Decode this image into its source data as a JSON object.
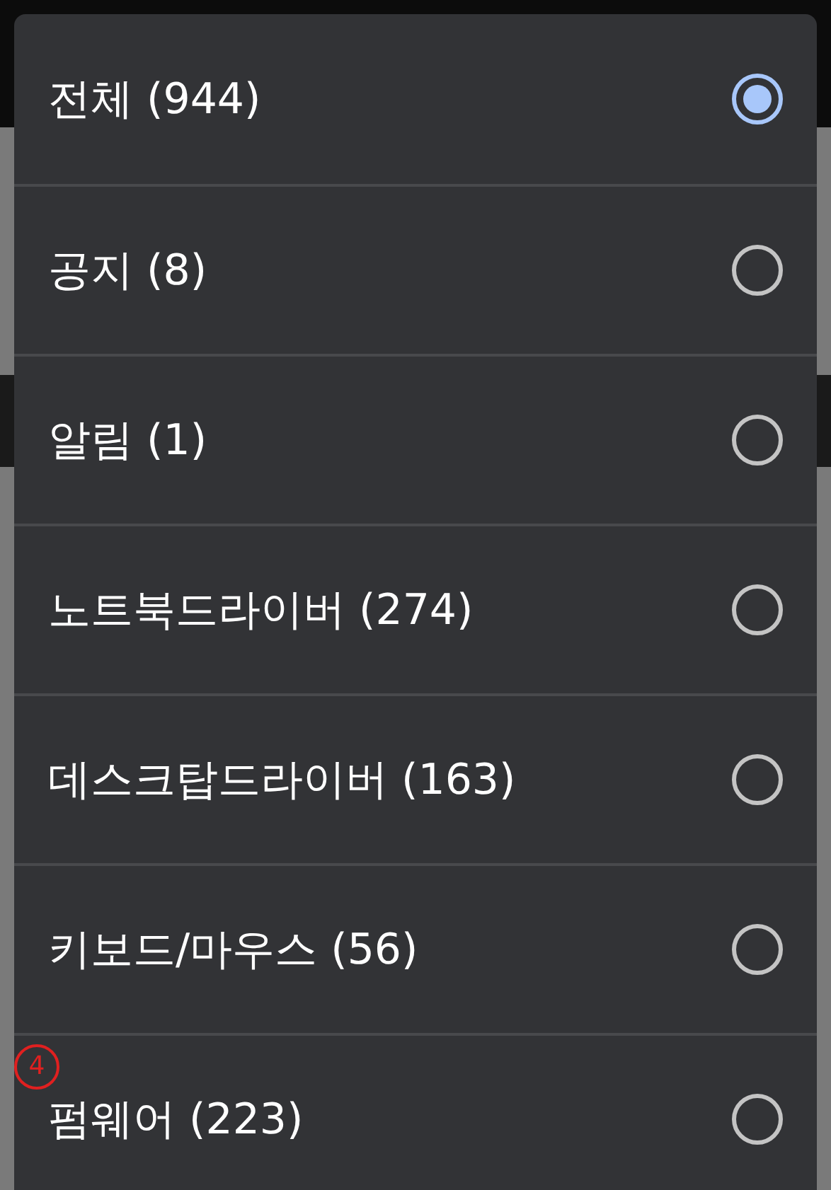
{
  "options": [
    {
      "label": "전체 (944)",
      "selected": true
    },
    {
      "label": "공지 (8)",
      "selected": false
    },
    {
      "label": "알림 (1)",
      "selected": false
    },
    {
      "label": "노트북드라이버 (274)",
      "selected": false
    },
    {
      "label": "데스크탑드라이버 (163)",
      "selected": false
    },
    {
      "label": "키보드/마우스 (56)",
      "selected": false
    },
    {
      "label": "펌웨어 (223)",
      "selected": false,
      "annotation": "4"
    }
  ]
}
